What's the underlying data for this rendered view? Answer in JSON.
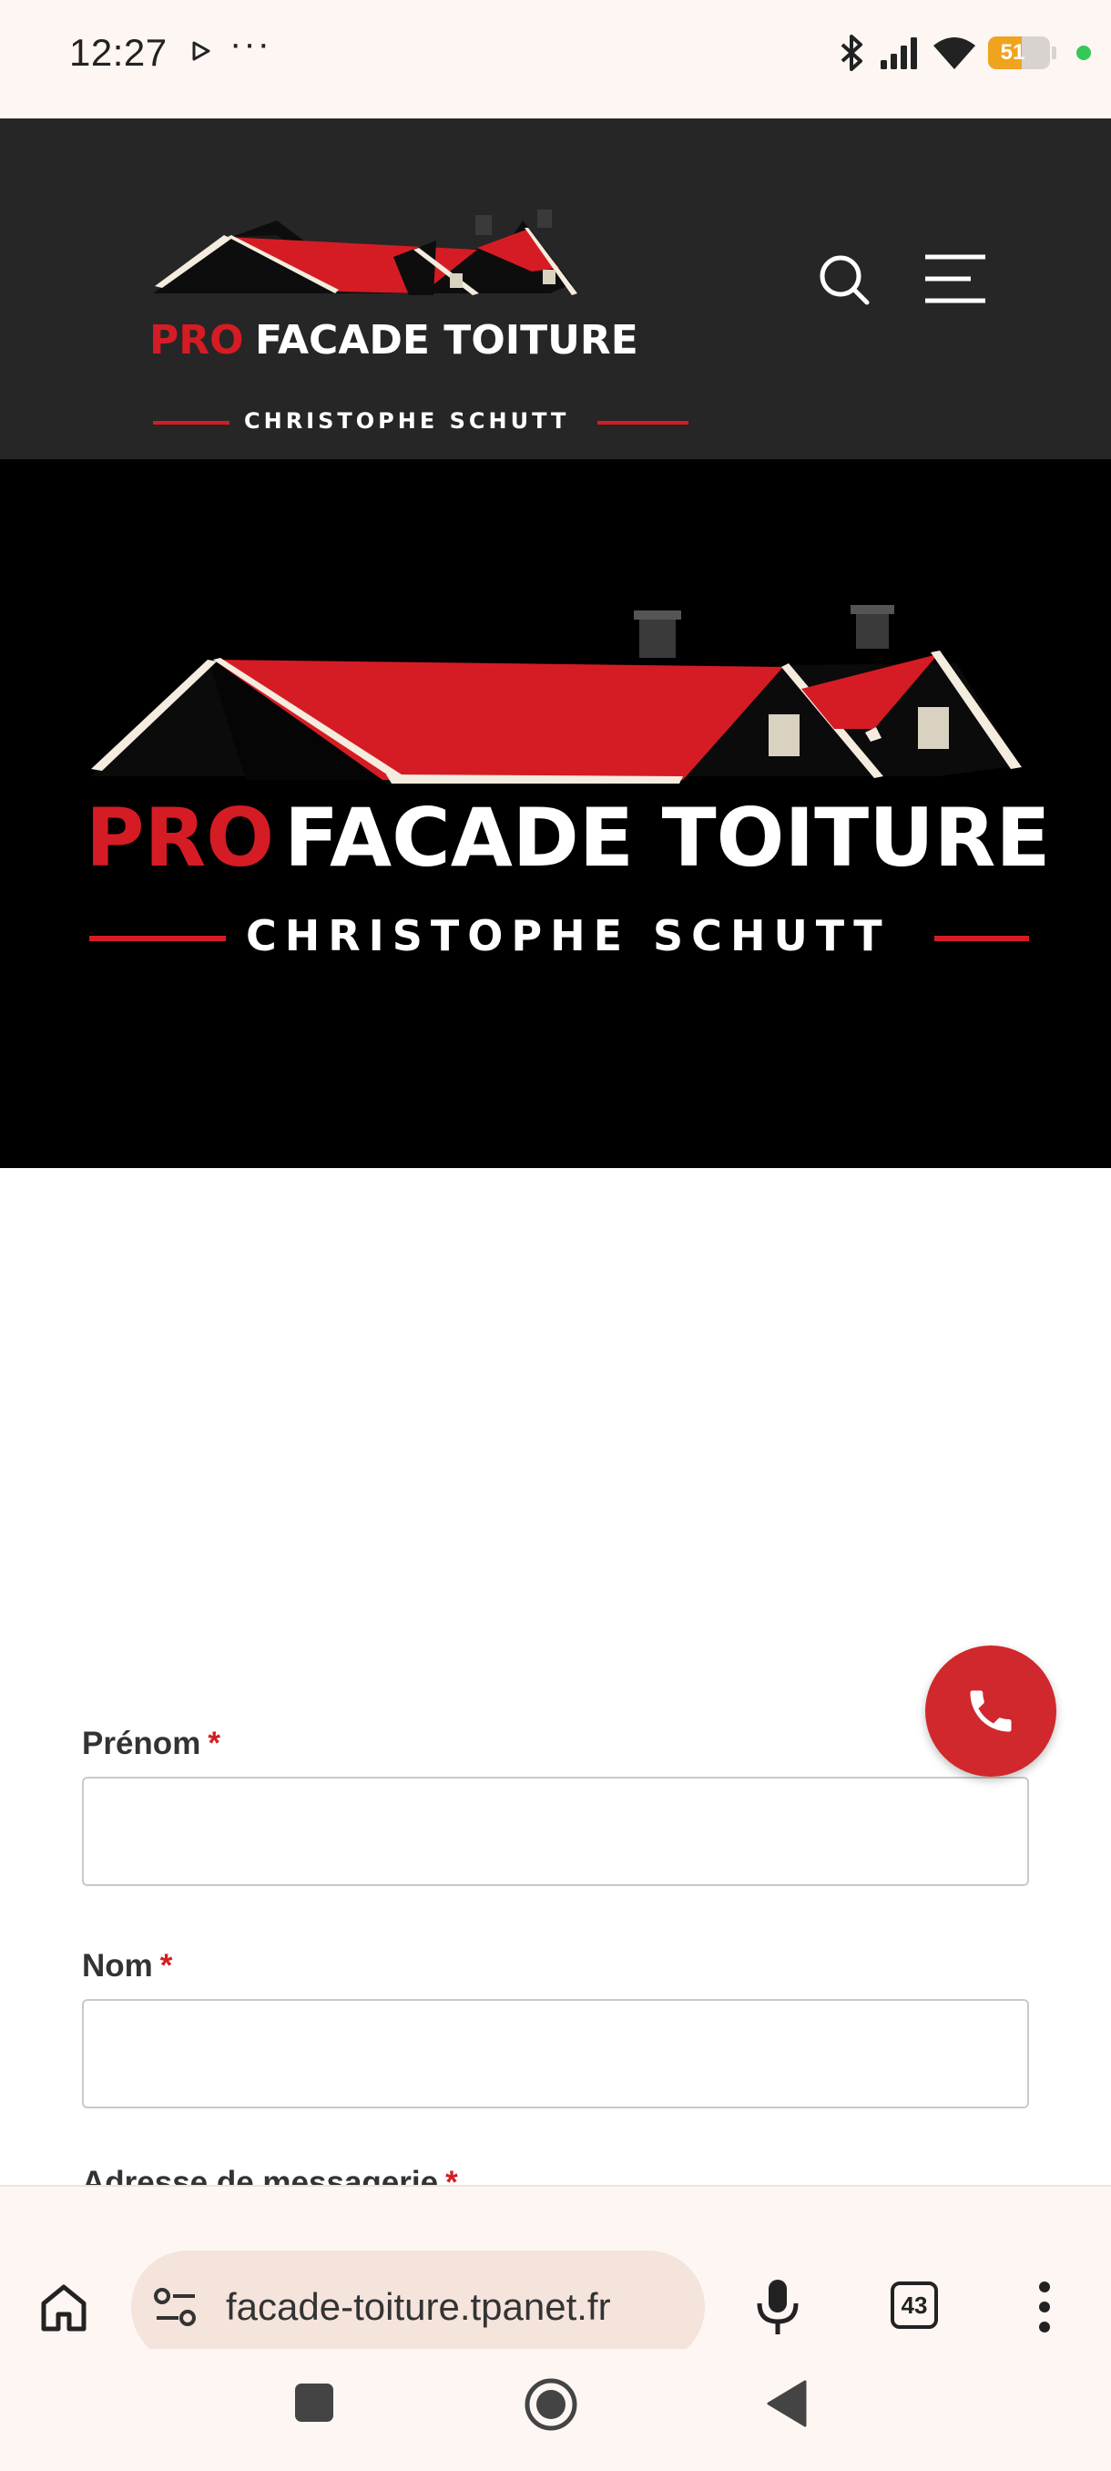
{
  "status_bar": {
    "time": "12:27",
    "more_dots": "···",
    "battery_level": "51",
    "icons": [
      "play-icon",
      "bluetooth-icon",
      "signal-icon",
      "wifi-icon",
      "battery-icon",
      "privacy-dot"
    ]
  },
  "header": {
    "logo": {
      "word_red": "PRO",
      "word_white": "FACADE TOITURE",
      "tagline": "CHRISTOPHE SCHUTT"
    },
    "icons": [
      "search-icon",
      "menu-icon"
    ]
  },
  "hero": {
    "logo": {
      "word_red": "PRO",
      "word_white": "FACADE TOITURE",
      "tagline": "CHRISTOPHE SCHUTT"
    }
  },
  "form": {
    "required_mark": "*",
    "fields": [
      {
        "label": "Prénom",
        "value": ""
      },
      {
        "label": "Nom",
        "value": ""
      }
    ],
    "partial_label": "Adresse de messagerie"
  },
  "call_button": {
    "icon": "phone-icon"
  },
  "browser": {
    "url": "facade-toiture.tpanet.fr",
    "tab_count": "43",
    "icons": [
      "home-icon",
      "site-settings-icon",
      "mic-icon",
      "tabs-icon",
      "more-vert-icon"
    ]
  },
  "nav": {
    "icons": [
      "recents-icon",
      "home-circle-icon",
      "back-icon"
    ]
  },
  "colors": {
    "brand_red": "#d51c24",
    "header_bg": "#262626",
    "hero_bg": "#000000",
    "fab_red": "#d0282d"
  }
}
